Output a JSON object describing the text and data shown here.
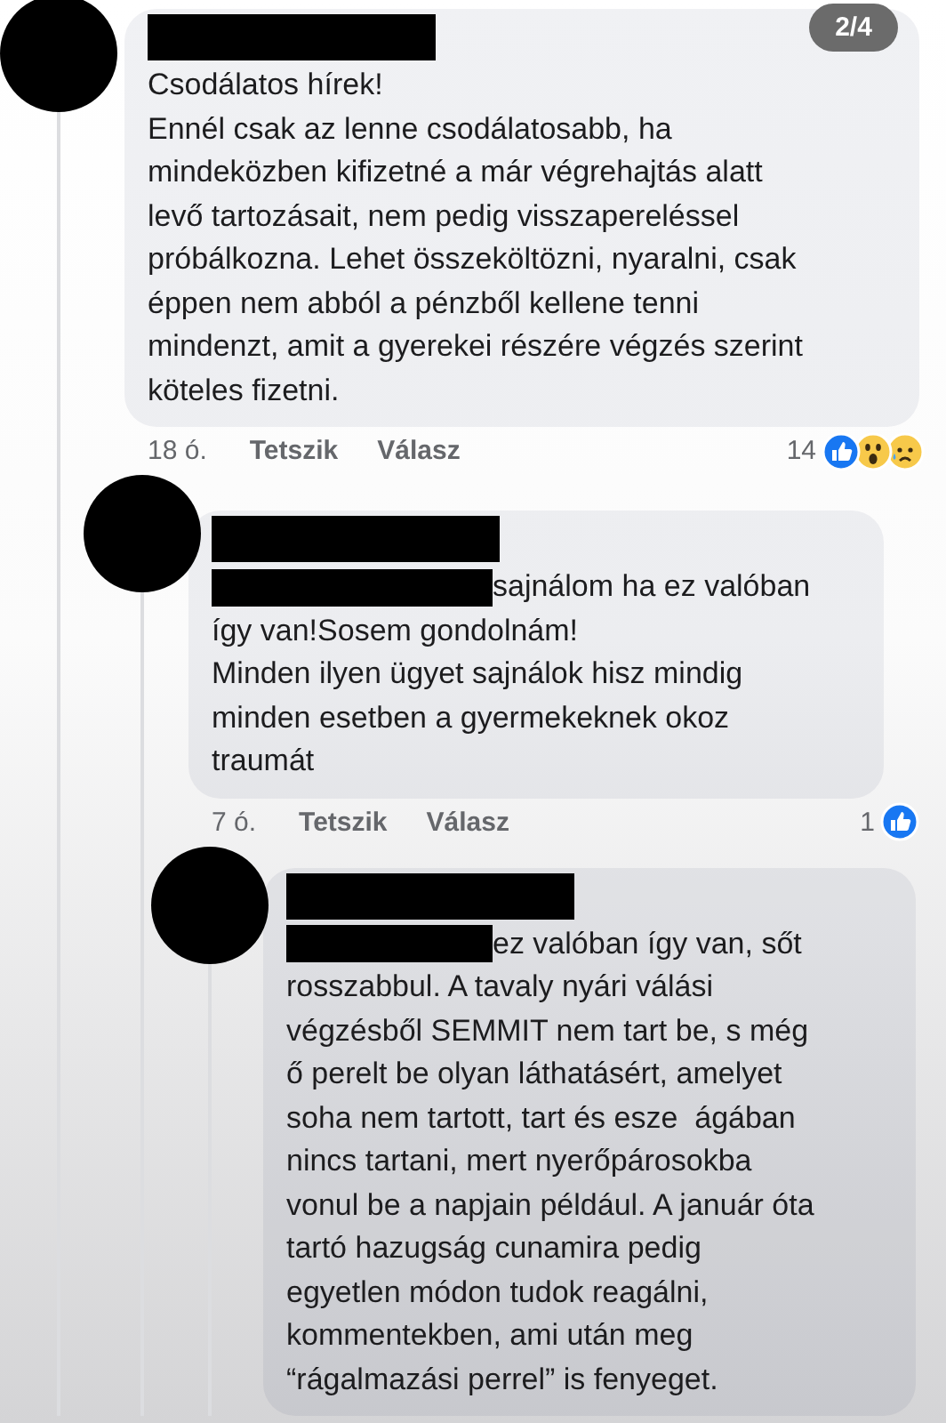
{
  "page_indicator": "2/4",
  "comments": [
    {
      "author_redacted": true,
      "body_redacted_start": false,
      "body": "Csodálatos hírek!\nEnnél csak az lenne csodálatosabb, ha\nmindeközben kifizetné a már végrehajtás alatt\nlevő tartozásait, nem pedig visszapereléssel\npróbálkozna. Lehet összeköltözni, nyaralni, csak\néppen nem abból a pénzből kellene tenni\nmindenzt, amit a gyerekei részére végzés szerint\nköteles fizetni.",
      "time": "18 ó.",
      "like": "Tetszik",
      "reply": "Válasz",
      "reaction_count": "14",
      "reactions": [
        {
          "kind": "like"
        },
        {
          "kind": "wow"
        },
        {
          "kind": "sad"
        }
      ],
      "replies": [
        {
          "author_redacted": true,
          "body_redacted_start": true,
          "body": "sajnálom ha ez valóban\nígy van!Sosem gondolnám!\nMinden ilyen ügyet sajnálok hisz mindig\nminden esetben a gyermekeknek okoz\ntraumát",
          "time": "7 ó.",
          "like": "Tetszik",
          "reply": "Válasz",
          "reaction_count": "1",
          "reactions": [
            {
              "kind": "like"
            }
          ],
          "replies": [
            {
              "author_redacted": true,
              "body_redacted_start": true,
              "body": "ez valóban így van, sőt\nrosszabbul. A tavaly nyári válási\nvégzésből SEMMIT nem tart be, s még\nő perelt be olyan láthatásért, amelyet\nsoha nem tartott, tart és esze  ágában\nnincs tartani, mert nyerőpárosokba\nvonul be a napjain például. A január óta\ntartó hazugság cunamira pedig\negyetlen módon tudok reagálni,\nkommentekben, ami után meg\n“rágalmazási perrel” is fenyeget."
            }
          ]
        }
      ]
    }
  ]
}
